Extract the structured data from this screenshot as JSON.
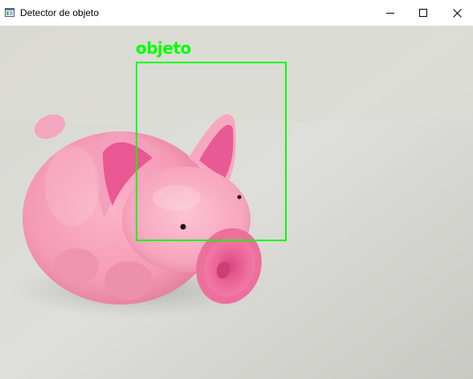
{
  "window": {
    "title": "Detector de objeto",
    "icon": "app-window-icon",
    "controls": {
      "minimize_icon": "minimize-icon",
      "maximize_icon": "maximize-icon",
      "close_icon": "close-icon"
    }
  },
  "detection": {
    "label": "objeto",
    "box_color": "#00ff00"
  }
}
